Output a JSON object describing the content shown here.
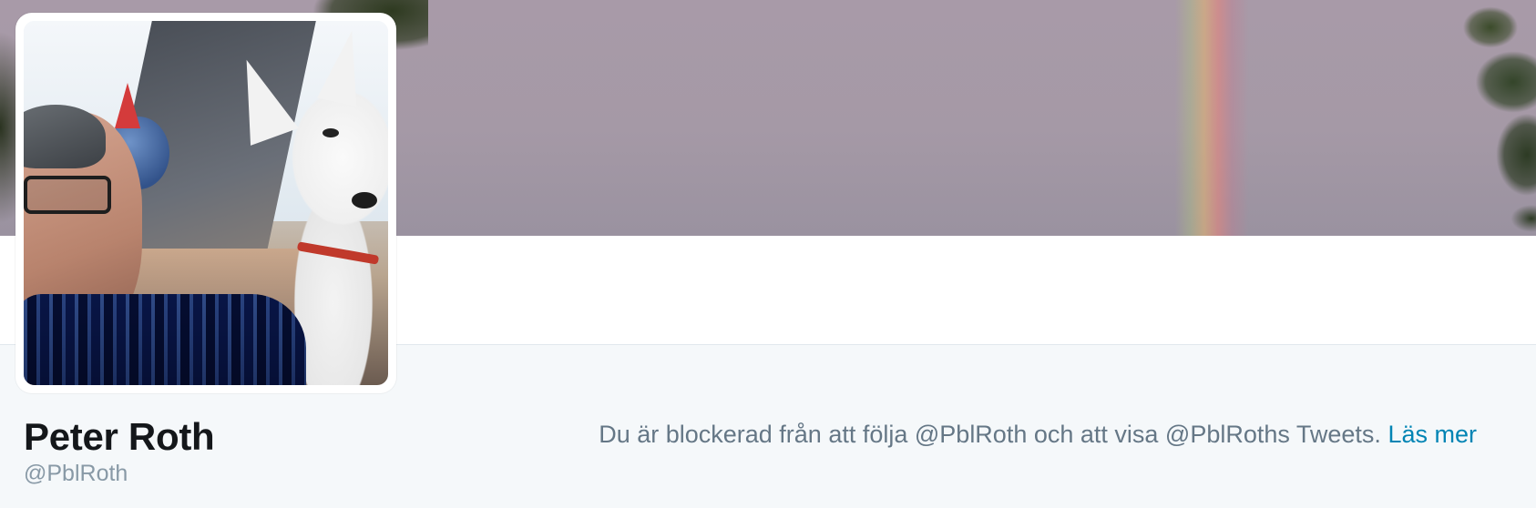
{
  "profile": {
    "name": "Peter Roth",
    "handle": "@PblRoth"
  },
  "notice": {
    "text": "Du är blockerad från att följa @PblRoth och att visa @PblRoths Tweets.",
    "link_label": "Läs mer"
  },
  "colors": {
    "page_background": "#f5f8fa",
    "name_text": "#14171a",
    "handle_text": "#8899a6",
    "notice_text": "#657786",
    "link": "#0084b4"
  },
  "icons": {
    "avatar": "profile-photo"
  }
}
